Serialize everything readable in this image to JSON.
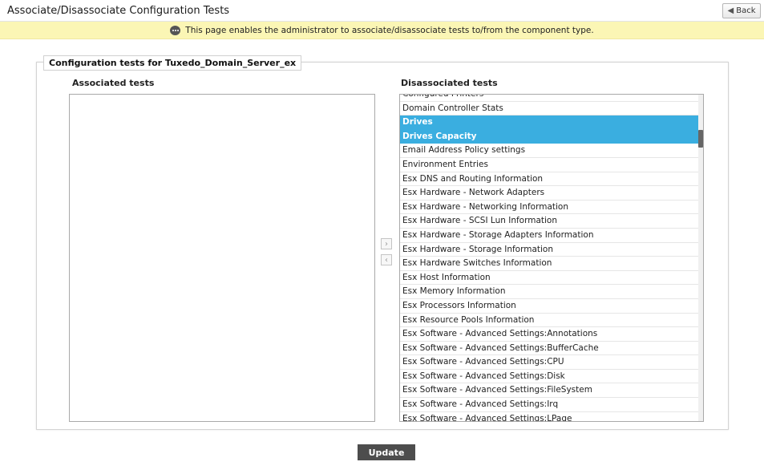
{
  "header": {
    "title": "Associate/Disassociate Configuration Tests",
    "back_label": "Back"
  },
  "info": {
    "message": "This page enables the administrator to associate/disassociate tests to/from the component type."
  },
  "panel": {
    "legend": "Configuration tests for Tuxedo_Domain_Server_ex",
    "associated_label": "Associated tests",
    "disassociated_label": "Disassociated tests"
  },
  "associated_tests": [],
  "disassociated_tests": [
    {
      "label": "Configured Printers",
      "selected": false
    },
    {
      "label": "Domain Controller Stats",
      "selected": false
    },
    {
      "label": "Drives",
      "selected": true
    },
    {
      "label": "Drives Capacity",
      "selected": true
    },
    {
      "label": "Email Address Policy settings",
      "selected": false
    },
    {
      "label": "Environment Entries",
      "selected": false
    },
    {
      "label": "Esx DNS and Routing Information",
      "selected": false
    },
    {
      "label": "Esx Hardware - Network Adapters",
      "selected": false
    },
    {
      "label": "Esx Hardware - Networking Information",
      "selected": false
    },
    {
      "label": "Esx Hardware - SCSI Lun Information",
      "selected": false
    },
    {
      "label": "Esx Hardware - Storage Adapters Information",
      "selected": false
    },
    {
      "label": "Esx Hardware - Storage Information",
      "selected": false
    },
    {
      "label": "Esx Hardware Switches Information",
      "selected": false
    },
    {
      "label": "Esx Host Information",
      "selected": false
    },
    {
      "label": "Esx Memory Information",
      "selected": false
    },
    {
      "label": "Esx Processors Information",
      "selected": false
    },
    {
      "label": "Esx Resource Pools Information",
      "selected": false
    },
    {
      "label": "Esx Software - Advanced Settings:Annotations",
      "selected": false
    },
    {
      "label": "Esx Software - Advanced Settings:BufferCache",
      "selected": false
    },
    {
      "label": "Esx Software - Advanced Settings:CPU",
      "selected": false
    },
    {
      "label": "Esx Software - Advanced Settings:Disk",
      "selected": false
    },
    {
      "label": "Esx Software - Advanced Settings:FileSystem",
      "selected": false
    },
    {
      "label": "Esx Software - Advanced Settings:Irq",
      "selected": false
    },
    {
      "label": "Esx Software - Advanced Settings:LPage",
      "selected": false
    }
  ],
  "controls": {
    "move_right_symbol": "›",
    "move_left_symbol": "‹",
    "update_label": "Update"
  },
  "colors": {
    "info_bar": "#fbf6b5",
    "selected_item": "#3aaee0",
    "update_button": "#4d4d4d"
  }
}
